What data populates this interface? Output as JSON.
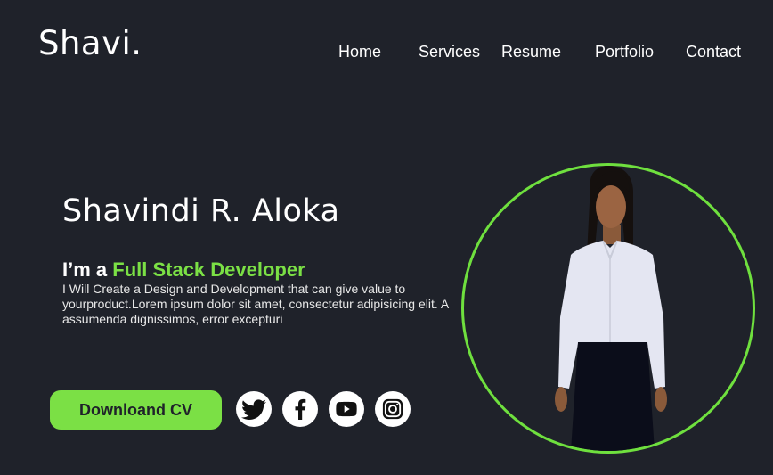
{
  "header": {
    "logo_text": "Shavi",
    "logo_dot": ".",
    "nav": [
      "Home",
      "Services",
      "Resume",
      "Portfolio",
      "Contact"
    ]
  },
  "hero": {
    "name": "Shavindi R. Aloka",
    "role_prefix": "I’m a ",
    "role_highlight": "Full Stack Developer",
    "description": " I Will Create a Design and Development that can give value to yourproduct.Lorem ipsum dolor sit amet, consectetur adipisicing elit. A assumenda dignissimos, error excepturi",
    "cta_label": "Downloand CV",
    "social_icons": [
      "twitter-icon",
      "facebook-icon",
      "youtube-icon",
      "instagram-icon"
    ]
  },
  "colors": {
    "background": "#1f222a",
    "accent": "#7be045",
    "text": "#ffffff"
  }
}
